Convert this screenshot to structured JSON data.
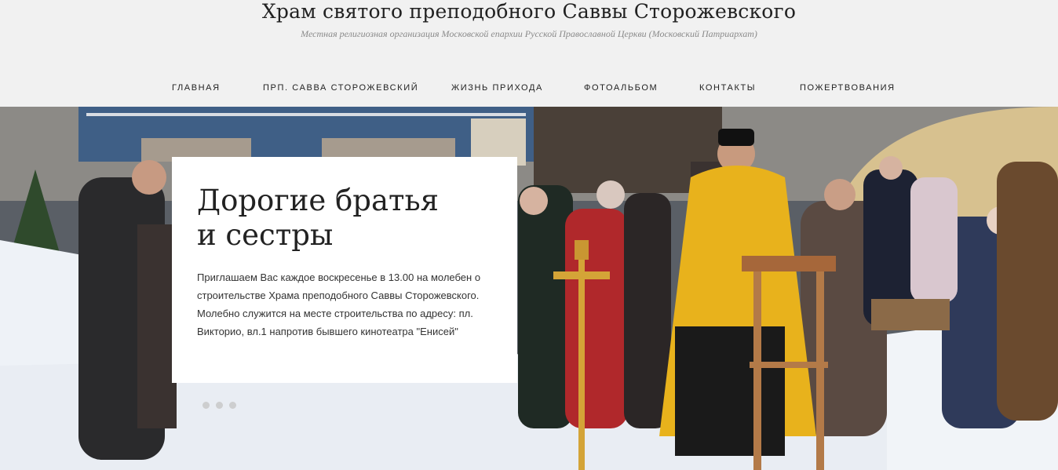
{
  "site": {
    "title": "Храм святого преподобного Саввы Сторожевского",
    "subtitle": "Местная религиозная организация Московской епархии Русской Православной Церкви (Московский Патриархат)"
  },
  "nav": {
    "items": [
      {
        "label": "ГЛАВНАЯ"
      },
      {
        "label": "ПРП. САВВА СТОРОЖЕВСКИЙ"
      },
      {
        "label": "ЖИЗНЬ ПРИХОДА"
      },
      {
        "label": "ФОТОАЛЬБОМ"
      },
      {
        "label": "КОНТАКТЫ"
      },
      {
        "label": "ПОЖЕРТВОВАНИЯ"
      }
    ]
  },
  "slider": {
    "title_line1": "Дорогие братья",
    "title_line2": "и сестры",
    "text": "Приглашаем Вас каждое воскресенье в 13.00 на молебен о строительстве Храма преподобного Саввы Сторожевского. Молебно служится на месте строительства по адресу: пл. Викторио, вл.1 напротив бывшего кинотеатра \"Енисей\"",
    "slide_count": 3,
    "active_slide": 1
  },
  "colors": {
    "header_bg": "#f1f1f1",
    "vestment_gold": "#e8b21c",
    "snow": "#eef2f7"
  }
}
